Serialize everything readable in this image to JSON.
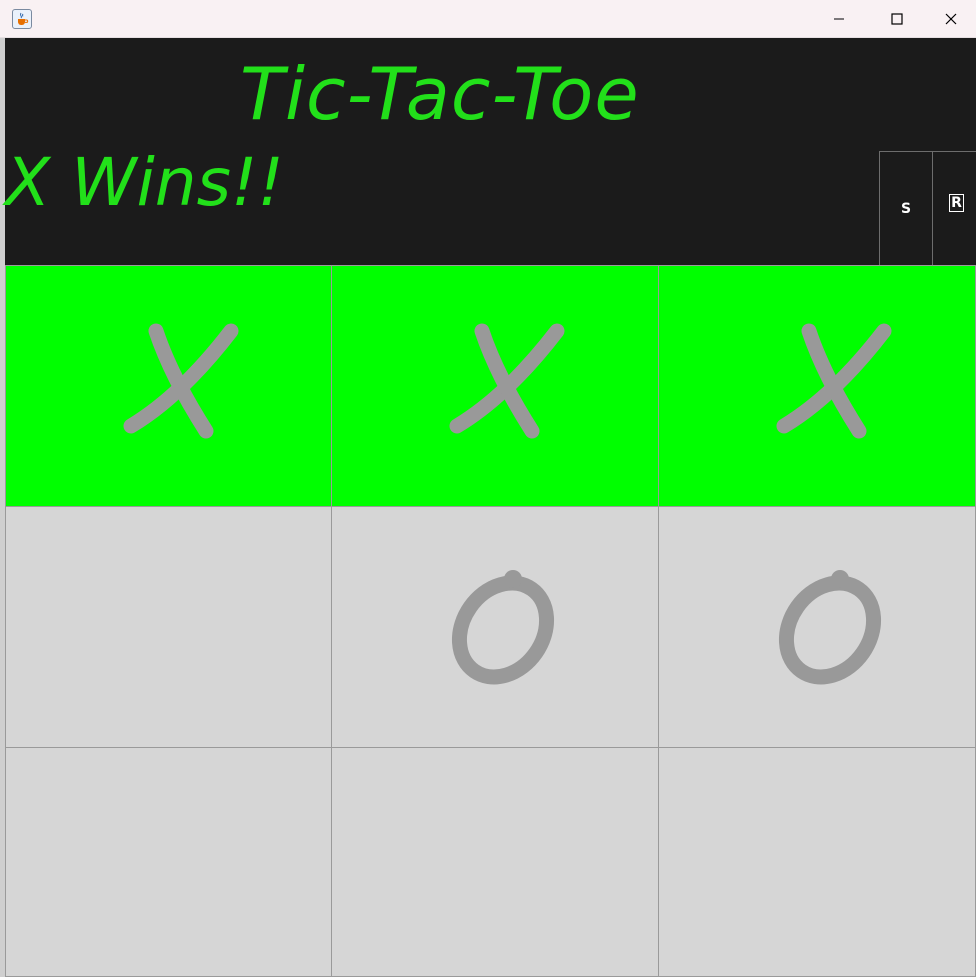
{
  "window": {
    "icon": "java-cup-icon",
    "controls": [
      "minimize-icon",
      "maximize-icon",
      "close-icon"
    ]
  },
  "header": {
    "title": "Tic-Tac-Toe",
    "status": "X Wins!!",
    "buttons": [
      {
        "label": "S"
      },
      {
        "label": "R"
      }
    ]
  },
  "colors": {
    "background": "#1b1b1b",
    "accent": "#22e01a",
    "win_cell": "#00ff00",
    "cell": "#d6d6d6",
    "mark": "#999999"
  },
  "board": {
    "cells": [
      {
        "mark": "X",
        "winning": true
      },
      {
        "mark": "X",
        "winning": true
      },
      {
        "mark": "X",
        "winning": true
      },
      {
        "mark": "",
        "winning": false
      },
      {
        "mark": "O",
        "winning": false
      },
      {
        "mark": "O",
        "winning": false
      },
      {
        "mark": "",
        "winning": false
      },
      {
        "mark": "",
        "winning": false
      },
      {
        "mark": "",
        "winning": false
      }
    ]
  }
}
